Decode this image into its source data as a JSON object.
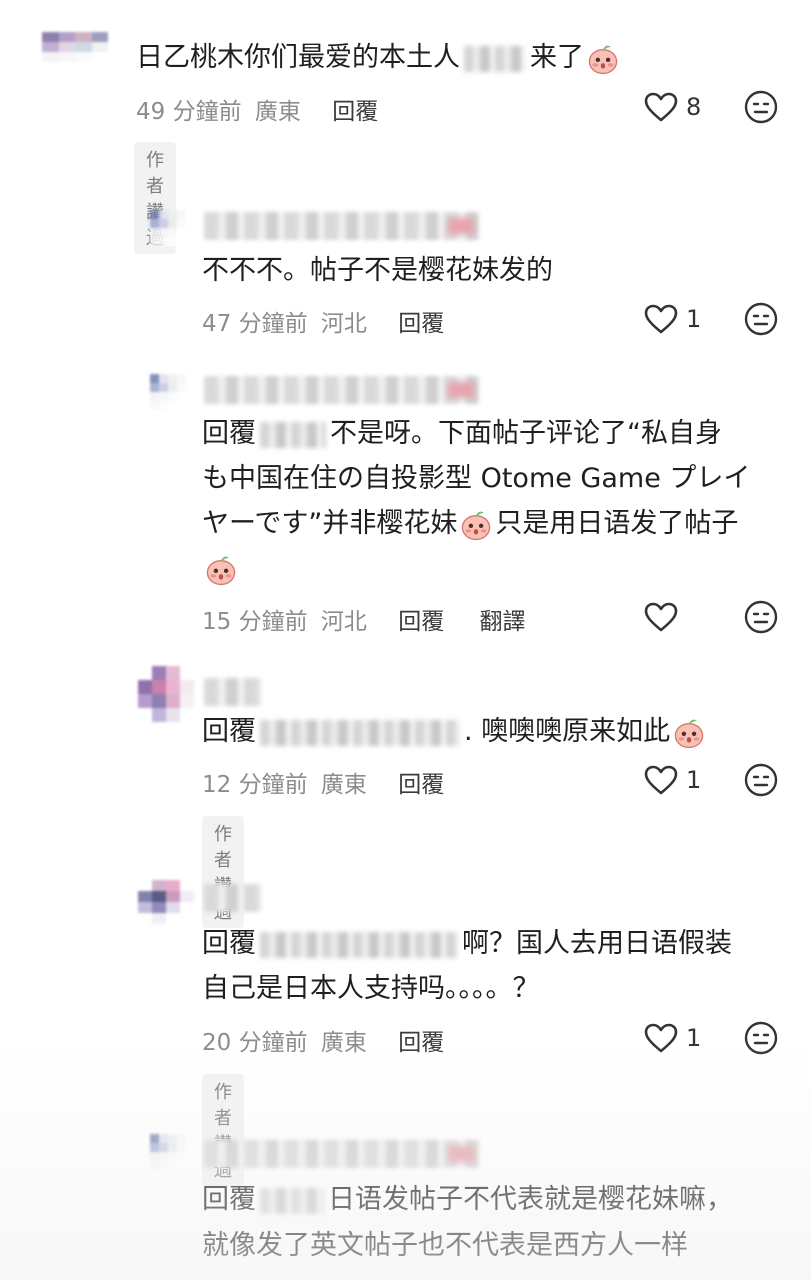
{
  "comments": [
    {
      "text_a": "日乙桃木你们最爱的本土人",
      "text_b": "来了",
      "time": "49 分鐘前",
      "region": "廣東",
      "reply": "回覆",
      "likes": "8",
      "badge": "作者讚過"
    },
    {
      "text": "不不不。帖子不是樱花妹发的",
      "time": "47 分鐘前",
      "region": "河北",
      "reply": "回覆",
      "likes": "1"
    },
    {
      "prefix": "回覆",
      "line1": "不是呀。下面帖子评论了“私自身",
      "line2": "も中国在住の自投影型 Otome Game プレイ",
      "line3a": "ヤーです”并非樱花妹",
      "line3b": "只是用日语发了帖子",
      "time": "15 分鐘前",
      "region": "河北",
      "reply": "回覆",
      "translate": "翻譯"
    },
    {
      "prefix": "回覆",
      "text": ". 噢噢噢原来如此",
      "time": "12 分鐘前",
      "region": "廣東",
      "reply": "回覆",
      "likes": "1",
      "badge": "作者讚過"
    },
    {
      "prefix": "回覆",
      "line1": "啊？国人去用日语假装",
      "line2": "自己是日本人支持吗。。。。？",
      "time": "20 分鐘前",
      "region": "廣東",
      "reply": "回覆",
      "likes": "1",
      "badge": "作者讚過"
    },
    {
      "prefix": "回覆",
      "line1": "日语发帖子不代表就是樱花妹嘛，",
      "line2": "就像发了英文帖子也不代表是西方人一样"
    }
  ],
  "icons": {
    "heart": "heart-outline-icon",
    "dislike": "neutral-face-icon",
    "emoji": "peach-blush-emoji"
  },
  "colors": {
    "text": "#1f1f1f",
    "meta": "#8c8c8c",
    "badge_bg": "#f2f2f2"
  }
}
